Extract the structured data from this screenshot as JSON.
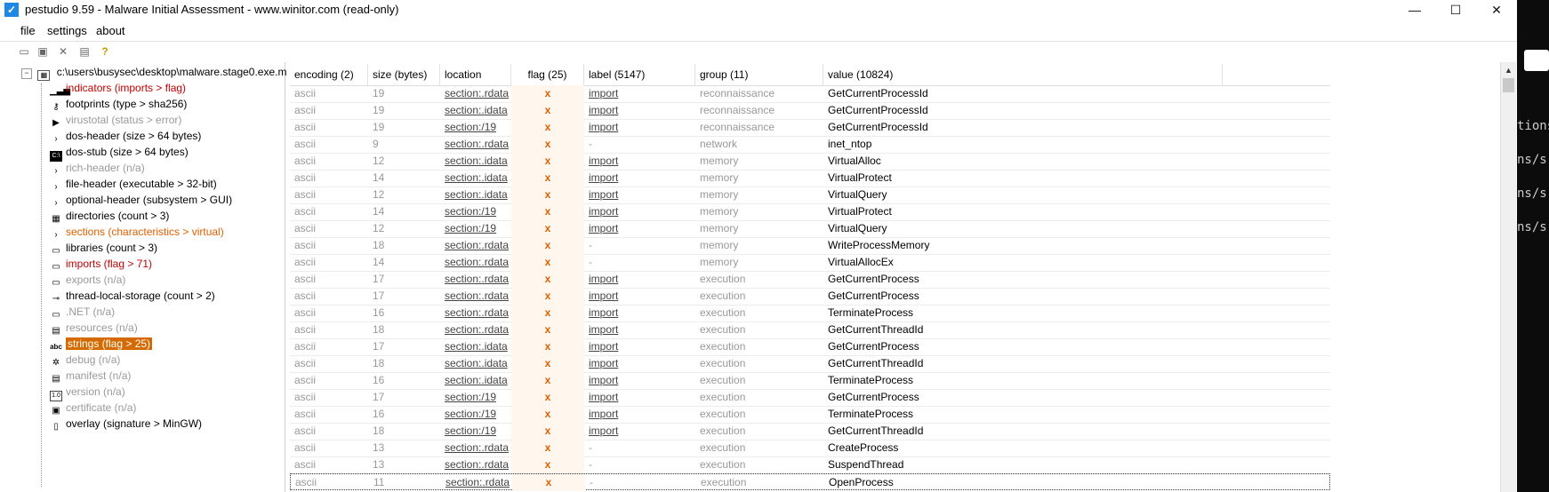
{
  "window": {
    "title": "pestudio 9.59 - Malware Initial Assessment - www.winitor.com (read-only)",
    "app_icon": "✓",
    "min": "—",
    "max": "☐",
    "close": "✕"
  },
  "menu": {
    "file": "file",
    "settings": "settings",
    "about": "about"
  },
  "toolbar": {
    "icons": [
      "open-icon",
      "save-icon",
      "close-icon",
      "list-icon",
      "help-icon"
    ]
  },
  "tree": {
    "root": {
      "expander": "−",
      "path": "c:\\users\\busysec\\desktop\\malware.stage0.exe.m"
    },
    "items": [
      {
        "label": "indicators (imports > flag)",
        "color": "red",
        "icon": "indicators-icon",
        "glyph": "▁▃▅"
      },
      {
        "label": "footprints (type > sha256)",
        "color": "black",
        "icon": "footprints-icon",
        "glyph": "⚷"
      },
      {
        "label": "virustotal (status > error)",
        "color": "gray",
        "icon": "virustotal-icon",
        "glyph": "▶"
      },
      {
        "label": "dos-header (size > 64 bytes)",
        "color": "black",
        "icon": "expander-icon",
        "glyph": "›"
      },
      {
        "label": "dos-stub (size > 64 bytes)",
        "color": "black",
        "icon": "dos-stub-icon",
        "glyph": "C:\\"
      },
      {
        "label": "rich-header (n/a)",
        "color": "gray",
        "icon": "expander-icon",
        "glyph": "›"
      },
      {
        "label": "file-header (executable > 32-bit)",
        "color": "black",
        "icon": "expander-icon",
        "glyph": "›"
      },
      {
        "label": "optional-header (subsystem > GUI)",
        "color": "black",
        "icon": "expander-icon",
        "glyph": "›"
      },
      {
        "label": "directories (count > 3)",
        "color": "black",
        "icon": "directories-icon",
        "glyph": "▦"
      },
      {
        "label": "sections (characteristics > virtual)",
        "color": "orange",
        "icon": "expander-icon",
        "glyph": "›"
      },
      {
        "label": "libraries (count > 3)",
        "color": "black",
        "icon": "libraries-icon",
        "glyph": "▭"
      },
      {
        "label": "imports (flag > 71)",
        "color": "red",
        "icon": "imports-icon",
        "glyph": "▭"
      },
      {
        "label": "exports (n/a)",
        "color": "gray",
        "icon": "exports-icon",
        "glyph": "▭"
      },
      {
        "label": "thread-local-storage (count > 2)",
        "color": "black",
        "icon": "tls-icon",
        "glyph": "⊸"
      },
      {
        "label": ".NET (n/a)",
        "color": "gray",
        "icon": "dotnet-icon",
        "glyph": "▭"
      },
      {
        "label": "resources (n/a)",
        "color": "gray",
        "icon": "resources-icon",
        "glyph": "▤"
      },
      {
        "label": "strings (flag > 25)",
        "color": "selected",
        "icon": "strings-icon",
        "glyph": "abc"
      },
      {
        "label": "debug (n/a)",
        "color": "gray",
        "icon": "debug-icon",
        "glyph": "✲"
      },
      {
        "label": "manifest (n/a)",
        "color": "gray",
        "icon": "manifest-icon",
        "glyph": "▤"
      },
      {
        "label": "version (n/a)",
        "color": "gray",
        "icon": "version-icon",
        "glyph": "1.0"
      },
      {
        "label": "certificate (n/a)",
        "color": "gray",
        "icon": "certificate-icon",
        "glyph": "▣"
      },
      {
        "label": "overlay (signature > MinGW)",
        "color": "black",
        "icon": "overlay-icon",
        "glyph": "▯"
      }
    ]
  },
  "table": {
    "headers": [
      "encoding (2)",
      "size (bytes)",
      "location",
      "flag (25)",
      "label (5147)",
      "group (11)",
      "value (10824)"
    ],
    "flag_mark": "x",
    "rows": [
      [
        "ascii",
        "19",
        "section:.rdata",
        "x",
        "import",
        "reconnaissance",
        "GetCurrentProcessId"
      ],
      [
        "ascii",
        "19",
        "section:.idata",
        "x",
        "import",
        "reconnaissance",
        "GetCurrentProcessId"
      ],
      [
        "ascii",
        "19",
        "section:/19",
        "x",
        "import",
        "reconnaissance",
        "GetCurrentProcessId"
      ],
      [
        "ascii",
        "9",
        "section:.rdata",
        "x",
        "-",
        "network",
        "inet_ntop"
      ],
      [
        "ascii",
        "12",
        "section:.idata",
        "x",
        "import",
        "memory",
        "VirtualAlloc"
      ],
      [
        "ascii",
        "14",
        "section:.idata",
        "x",
        "import",
        "memory",
        "VirtualProtect"
      ],
      [
        "ascii",
        "12",
        "section:.idata",
        "x",
        "import",
        "memory",
        "VirtualQuery"
      ],
      [
        "ascii",
        "14",
        "section:/19",
        "x",
        "import",
        "memory",
        "VirtualProtect"
      ],
      [
        "ascii",
        "12",
        "section:/19",
        "x",
        "import",
        "memory",
        "VirtualQuery"
      ],
      [
        "ascii",
        "18",
        "section:.rdata",
        "x",
        "-",
        "memory",
        "WriteProcessMemory"
      ],
      [
        "ascii",
        "14",
        "section:.rdata",
        "x",
        "-",
        "memory",
        "VirtualAllocEx"
      ],
      [
        "ascii",
        "17",
        "section:.rdata",
        "x",
        "import",
        "execution",
        "GetCurrentProcess"
      ],
      [
        "ascii",
        "17",
        "section:.rdata",
        "x",
        "import",
        "execution",
        "GetCurrentProcess"
      ],
      [
        "ascii",
        "16",
        "section:.rdata",
        "x",
        "import",
        "execution",
        "TerminateProcess"
      ],
      [
        "ascii",
        "18",
        "section:.rdata",
        "x",
        "import",
        "execution",
        "GetCurrentThreadId"
      ],
      [
        "ascii",
        "17",
        "section:.idata",
        "x",
        "import",
        "execution",
        "GetCurrentProcess"
      ],
      [
        "ascii",
        "18",
        "section:.idata",
        "x",
        "import",
        "execution",
        "GetCurrentThreadId"
      ],
      [
        "ascii",
        "16",
        "section:.idata",
        "x",
        "import",
        "execution",
        "TerminateProcess"
      ],
      [
        "ascii",
        "17",
        "section:/19",
        "x",
        "import",
        "execution",
        "GetCurrentProcess"
      ],
      [
        "ascii",
        "16",
        "section:/19",
        "x",
        "import",
        "execution",
        "TerminateProcess"
      ],
      [
        "ascii",
        "18",
        "section:/19",
        "x",
        "import",
        "execution",
        "GetCurrentThreadId"
      ],
      [
        "ascii",
        "13",
        "section:.rdata",
        "x",
        "-",
        "execution",
        "CreateProcess"
      ],
      [
        "ascii",
        "13",
        "section:.rdata",
        "x",
        "-",
        "execution",
        "SuspendThread"
      ],
      [
        "ascii",
        "11",
        "section:.rdata",
        "x",
        "-",
        "execution",
        "OpenProcess"
      ]
    ]
  },
  "terminal": {
    "lines": [
      "tions",
      "ns/s",
      "ns/s",
      "ns/s"
    ]
  },
  "colors": {
    "selected_bg": "#d46a00",
    "red": "#c40000",
    "orange": "#e06000",
    "gray": "#999999"
  }
}
